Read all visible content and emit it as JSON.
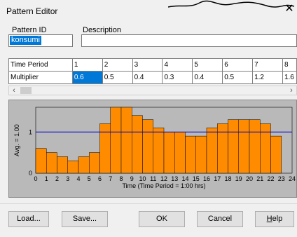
{
  "window": {
    "title": "Pattern Editor"
  },
  "fields": {
    "pattern_id_label": "Pattern ID",
    "pattern_id_value": "konsumi",
    "description_label": "Description",
    "description_value": ""
  },
  "table": {
    "row1_label": "Time Period",
    "row2_label": "Multiplier",
    "periods": [
      "1",
      "2",
      "3",
      "4",
      "5",
      "6",
      "7",
      "8"
    ],
    "multipliers": [
      "0.6",
      "0.5",
      "0.4",
      "0.3",
      "0.4",
      "0.5",
      "1.2",
      "1.6"
    ]
  },
  "chart_data": {
    "type": "bar",
    "ylabel": "Avg. = 1.00",
    "xlabel": "Time (Time Period = 1:00 hrs)",
    "x_ticks": [
      "0",
      "1",
      "2",
      "3",
      "4",
      "5",
      "6",
      "7",
      "8",
      "9",
      "10",
      "11",
      "12",
      "13",
      "14",
      "15",
      "16",
      "17",
      "18",
      "19",
      "20",
      "21",
      "22",
      "23",
      "24"
    ],
    "y_ticks": [
      "0",
      "1"
    ],
    "ylim": [
      0,
      1.6
    ],
    "average": 1.0,
    "values": [
      0.6,
      0.5,
      0.4,
      0.3,
      0.4,
      0.5,
      1.2,
      1.6,
      1.6,
      1.4,
      1.3,
      1.1,
      1.0,
      1.0,
      0.9,
      0.9,
      1.1,
      1.2,
      1.3,
      1.3,
      1.3,
      1.2,
      0.9
    ],
    "bar_color": "#ff8c00",
    "avg_line_color": "#0000cc"
  },
  "buttons": {
    "load": "Load...",
    "save": "Save...",
    "ok": "OK",
    "cancel": "Cancel",
    "help": "Help"
  }
}
